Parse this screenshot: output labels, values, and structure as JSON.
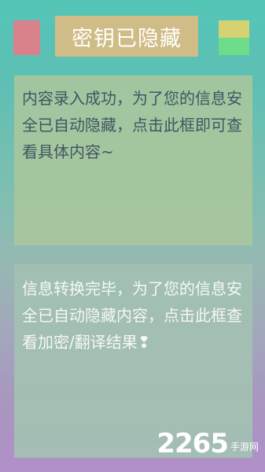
{
  "header": {
    "title": "密钥已隐藏",
    "colors": {
      "left_swatch": "#d9828c",
      "title_bg": "#d0bc86",
      "right_swatch_top": "#d6d271",
      "right_swatch_bottom": "#6fdc8c"
    }
  },
  "input_panel": {
    "text": "内容录入成功，为了您的信息安全已自动隐藏，点击此框即可查看具体内容~"
  },
  "output_panel": {
    "text": "信息转换完毕，为了您的信息安全已自动隐藏内容，点击此框查看加密/翻译结果❢"
  },
  "watermark": {
    "number": "2265",
    "label": "手游网"
  }
}
